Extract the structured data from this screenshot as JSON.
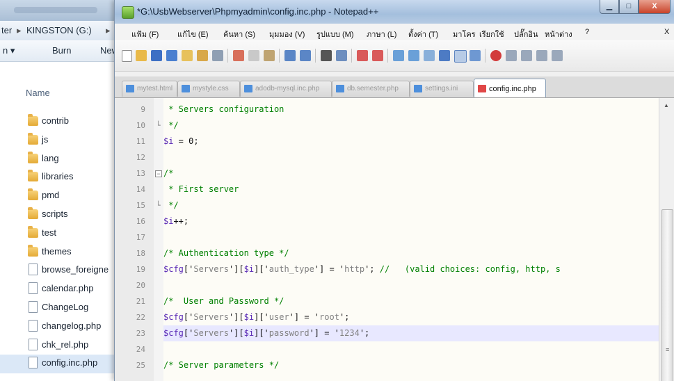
{
  "explorer": {
    "address": {
      "prefix": "ter",
      "arrow": "▸",
      "location": "KINGSTON (G:)",
      "arrow2": "▸"
    },
    "toolbar": {
      "organize": "n ▾",
      "burn": "Burn",
      "new": "New"
    },
    "column_header": "Name",
    "items": [
      {
        "name": "contrib",
        "type": "folder"
      },
      {
        "name": "js",
        "type": "folder"
      },
      {
        "name": "lang",
        "type": "folder"
      },
      {
        "name": "libraries",
        "type": "folder"
      },
      {
        "name": "pmd",
        "type": "folder"
      },
      {
        "name": "scripts",
        "type": "folder"
      },
      {
        "name": "test",
        "type": "folder"
      },
      {
        "name": "themes",
        "type": "folder"
      },
      {
        "name": "browse_foreigne",
        "type": "file"
      },
      {
        "name": "calendar.php",
        "type": "file"
      },
      {
        "name": "ChangeLog",
        "type": "file"
      },
      {
        "name": "changelog.php",
        "type": "file"
      },
      {
        "name": "chk_rel.php",
        "type": "file"
      },
      {
        "name": "config.inc.php",
        "type": "file",
        "selected": true
      }
    ]
  },
  "notepad": {
    "title": "*G:\\UsbWebserver\\Phpmyadmin\\config.inc.php - Notepad++",
    "window_buttons": {
      "minimize": "▁",
      "maximize": "□",
      "close": "X"
    },
    "menu": [
      "แฟ้ม (F)",
      "แก้ไข (E)",
      "ค้นหา (S)",
      "มุมมอง (V)",
      "รูปแบบ (M)",
      "ภาษา (L)",
      "ตั้งค่า (T)",
      "มาโคร",
      "เรียกใช้",
      "ปลั๊กอิน",
      "หน้าต่าง",
      "?"
    ],
    "menu_close": "X",
    "tabs": [
      {
        "label": "mytest.html",
        "active": false
      },
      {
        "label": "mystyle.css",
        "active": false
      },
      {
        "label": "adodb-mysql.inc.php",
        "active": false
      },
      {
        "label": "db.semester.php",
        "active": false
      },
      {
        "label": "settings.ini",
        "active": false
      },
      {
        "label": "config.inc.php",
        "active": true
      }
    ],
    "lines": [
      {
        "num": "9",
        "fold": "",
        "segments": [
          {
            "t": " * Servers configuration",
            "k": "c"
          }
        ]
      },
      {
        "num": "10",
        "fold": "-",
        "segments": [
          {
            "t": " */",
            "k": "c"
          }
        ]
      },
      {
        "num": "11",
        "fold": "",
        "segments": [
          {
            "t": "$i",
            "k": "v"
          },
          {
            "t": " = ",
            "k": "o"
          },
          {
            "t": "0",
            "k": "o"
          },
          {
            "t": ";",
            "k": "o"
          }
        ]
      },
      {
        "num": "12",
        "fold": "",
        "segments": []
      },
      {
        "num": "13",
        "fold": "box",
        "segments": [
          {
            "t": "/*",
            "k": "c"
          }
        ]
      },
      {
        "num": "14",
        "fold": "",
        "segments": [
          {
            "t": " * First server",
            "k": "c"
          }
        ]
      },
      {
        "num": "15",
        "fold": "-",
        "segments": [
          {
            "t": " */",
            "k": "c"
          }
        ]
      },
      {
        "num": "16",
        "fold": "",
        "segments": [
          {
            "t": "$i",
            "k": "v"
          },
          {
            "t": "++;",
            "k": "o"
          }
        ]
      },
      {
        "num": "17",
        "fold": "",
        "segments": []
      },
      {
        "num": "18",
        "fold": "",
        "segments": [
          {
            "t": "/* Authentication type */",
            "k": "c"
          }
        ]
      },
      {
        "num": "19",
        "fold": "",
        "segments": [
          {
            "t": "$cfg",
            "k": "v"
          },
          {
            "t": "['",
            "k": "o"
          },
          {
            "t": "Servers",
            "k": "s"
          },
          {
            "t": "'][",
            "k": "o"
          },
          {
            "t": "$i",
            "k": "v"
          },
          {
            "t": "]['",
            "k": "o"
          },
          {
            "t": "auth_type",
            "k": "s"
          },
          {
            "t": "'] = '",
            "k": "o"
          },
          {
            "t": "http",
            "k": "s"
          },
          {
            "t": "'; ",
            "k": "o"
          },
          {
            "t": "//   (valid choices: config, http, s",
            "k": "c"
          }
        ]
      },
      {
        "num": "20",
        "fold": "",
        "segments": []
      },
      {
        "num": "21",
        "fold": "",
        "segments": [
          {
            "t": "/*  User and Password */",
            "k": "c"
          }
        ]
      },
      {
        "num": "22",
        "fold": "",
        "segments": [
          {
            "t": "$cfg",
            "k": "v"
          },
          {
            "t": "['",
            "k": "o"
          },
          {
            "t": "Servers",
            "k": "s"
          },
          {
            "t": "'][",
            "k": "o"
          },
          {
            "t": "$i",
            "k": "v"
          },
          {
            "t": "]['",
            "k": "o"
          },
          {
            "t": "user",
            "k": "s"
          },
          {
            "t": "'] = '",
            "k": "o"
          },
          {
            "t": "root",
            "k": "s"
          },
          {
            "t": "';",
            "k": "o"
          }
        ]
      },
      {
        "num": "23",
        "fold": "",
        "current": true,
        "segments": [
          {
            "t": "$cfg",
            "k": "v"
          },
          {
            "t": "['",
            "k": "o"
          },
          {
            "t": "Servers",
            "k": "s"
          },
          {
            "t": "'][",
            "k": "o"
          },
          {
            "t": "$i",
            "k": "v"
          },
          {
            "t": "]['",
            "k": "o"
          },
          {
            "t": "password",
            "k": "s"
          },
          {
            "t": "'] = '",
            "k": "o"
          },
          {
            "t": "1234",
            "k": "s"
          },
          {
            "t": "';",
            "k": "o"
          }
        ]
      },
      {
        "num": "24",
        "fold": "",
        "segments": []
      },
      {
        "num": "25",
        "fold": "",
        "segments": [
          {
            "t": "/* Server parameters */",
            "k": "c"
          }
        ]
      }
    ],
    "colors": {
      "comment": "#008000",
      "variable": "#5a2ab5",
      "string": "#808080",
      "current_line": "#e8e8ff",
      "active_tab_icon": "#e04747",
      "tab_icon": "#4d8fdc"
    }
  }
}
